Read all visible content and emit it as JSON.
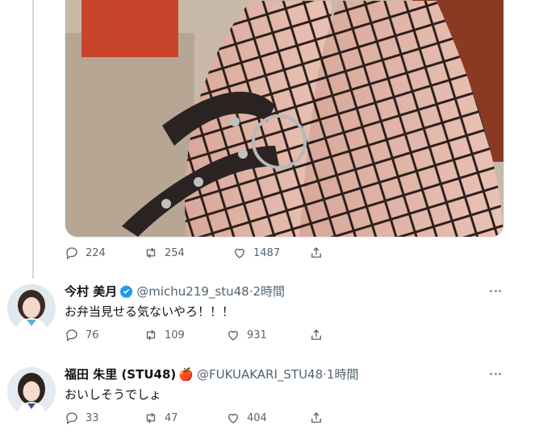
{
  "top_tweet": {
    "media_alt": "photo",
    "stats": {
      "replies": "224",
      "retweets": "254",
      "likes": "1487"
    }
  },
  "replies": [
    {
      "name": "今村 美月",
      "verified": true,
      "handle_time": "@michu219_stu48·2時間",
      "text": "お弁当見せる気ないやろ！！！",
      "stats": {
        "replies": "76",
        "retweets": "109",
        "likes": "931"
      }
    },
    {
      "name": "福田 朱里 (STU48)",
      "emoji": "🍎",
      "handle_time": "@FUKUAKARI_STU48·1時間",
      "text": "おいしそうでしょ",
      "stats": {
        "replies": "33",
        "retweets": "47",
        "likes": "404"
      }
    }
  ],
  "colors": {
    "accent": "#1d9bf0",
    "muted": "#536471",
    "thread_line": "#cfd9de"
  },
  "icons": [
    "reply-icon",
    "retweet-icon",
    "like-icon",
    "share-icon",
    "verified-icon",
    "more-icon"
  ]
}
